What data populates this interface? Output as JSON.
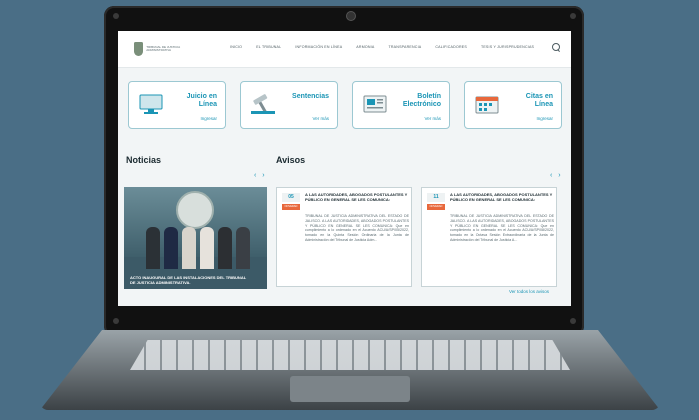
{
  "nav": {
    "logo_text": "TRIBUNAL DE JUSTICIA ADMINISTRATIVA",
    "items": [
      "INICIO",
      "EL TRIBUNAL",
      "INFORMACIÓN EN LÍNEA",
      "ARMONIA",
      "TRANSPARENCIA",
      "CALIFICADORES",
      "TESIS Y JURISPRUDENCIAS"
    ]
  },
  "cards": [
    {
      "title": "Juicio en\nLínea",
      "sub": "Ingresar",
      "icon": "monitor-icon"
    },
    {
      "title": "Sentencias",
      "sub": "Ver más",
      "icon": "gavel-icon"
    },
    {
      "title": "Boletín\nElectrónico",
      "sub": "Ver más",
      "icon": "newspaper-icon"
    },
    {
      "title": "Citas en\nLínea",
      "sub": "Ingresar",
      "icon": "calendar-icon"
    }
  ],
  "noticias": {
    "title": "Noticias",
    "caption": "ACTO INAUGURAL DE LAS INSTALACIONES DEL TRIBUNAL DE JUSTICIA ADMINISTRATIVA."
  },
  "avisos": {
    "title": "Avisos",
    "items": [
      {
        "date": "05",
        "badge": "NOVEDAD",
        "head": "A LAS AUTORIDADES, ABOGADOS POSTULANTES Y PÚBLICO EN GENERAL SE LES COMUNICA:",
        "body": "TRIBUNAL DE JUSTICIA ADMINISTRATIVA DEL ESTADO DE JALISCO. A LAS AUTORIDADES, ABOGADOS POSTULANTES Y PÚBLICO EN GENERAL SE LES COMUNICA: Que en cumplimiento a lo ordenado en el Acuerdo ACU/A/SP/05/2022, tomado en la Quinta Sesión Ordinaria de la Junta de Administración del Tribunal de Justicia Adm..."
      },
      {
        "date": "11",
        "badge": "NOVEDAD",
        "head": "A LAS AUTORIDADES, ABOGADOS POSTULANTES Y PÚBLICO EN GENERAL SE LES COMUNICA:",
        "body": "TRIBUNAL DE JUSTICIA ADMINISTRATIVA DEL ESTADO DE JALISCO. A LAS AUTORIDADES, ABOGADOS POSTULANTES Y PÚBLICO EN GENERAL SE LES COMUNICA: Que en cumplimiento a lo ordenado en el Acuerdo ACU/A/SP/08/2022, tomado en la Octava Sesión Extraordinaria de la Junta de Administración del Tribunal de Justicia A..."
      }
    ],
    "see_all": "Ver todos los avisos"
  },
  "arrows": "‹ ›",
  "colors": {
    "accent": "#1b95b5",
    "badge": "#e8683c",
    "frame": "#111111",
    "background": "#4a6e86"
  }
}
